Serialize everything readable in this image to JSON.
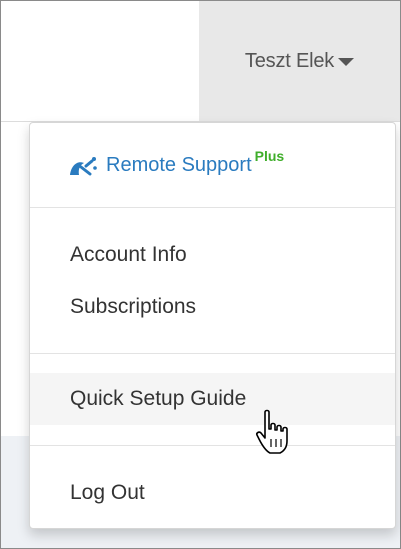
{
  "header": {
    "user_name": "Teszt Elek",
    "caret_icon": "caret-down-icon"
  },
  "dropdown": {
    "remote_support": {
      "icon": "remote-support-icon",
      "label": "Remote Support",
      "badge": "Plus"
    },
    "items": [
      {
        "label": "Account Info"
      },
      {
        "label": "Subscriptions"
      },
      {
        "label": "Quick Setup Guide",
        "hovered": true
      },
      {
        "label": "Log Out"
      }
    ]
  },
  "cursor": "hand-pointer-icon",
  "colors": {
    "link_blue": "#2a7bbf",
    "plus_green": "#3fae2a",
    "toggle_bg": "#e8e8e8",
    "hover_bg": "#f5f5f5"
  }
}
